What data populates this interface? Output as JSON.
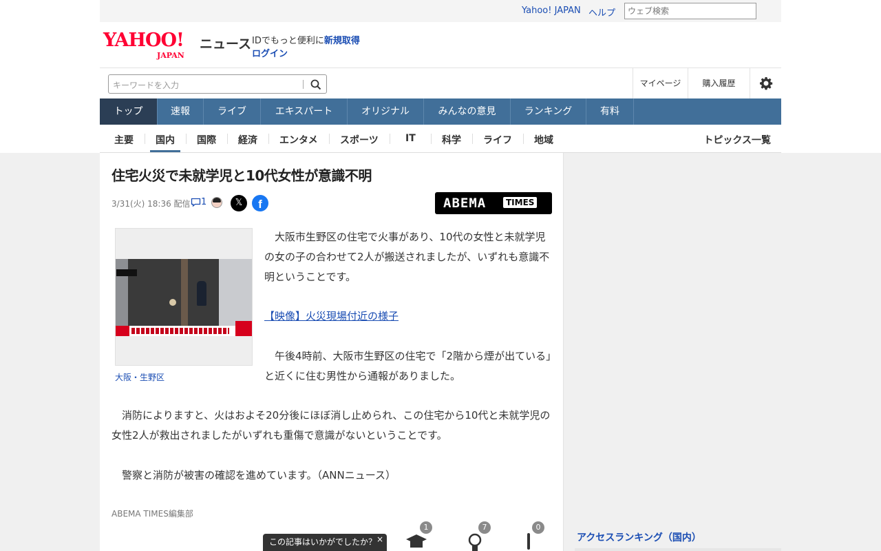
{
  "util": {
    "yahoo_japan": "Yahoo! JAPAN",
    "help": "ヘルプ",
    "web_search_placeholder": "ウェブ検索"
  },
  "header": {
    "logo_main": "YAHOO!",
    "logo_sub": "JAPAN",
    "service_name": "ニュース",
    "id_text": "IDでもっと便利に",
    "signup": "新規取得",
    "login": "ログイン"
  },
  "search": {
    "placeholder": "キーワードを入力",
    "mypage": "マイページ",
    "history": "購入履歴"
  },
  "main_nav": [
    {
      "label": "トップ",
      "active": true
    },
    {
      "label": "速報"
    },
    {
      "label": "ライブ"
    },
    {
      "label": "エキスパート"
    },
    {
      "label": "オリジナル"
    },
    {
      "label": "みんなの意見"
    },
    {
      "label": "ランキング"
    },
    {
      "label": "有料"
    }
  ],
  "sub_nav": [
    {
      "label": "主要"
    },
    {
      "label": "国内",
      "active": true
    },
    {
      "label": "国際"
    },
    {
      "label": "経済"
    },
    {
      "label": "エンタメ"
    },
    {
      "label": "スポーツ"
    },
    {
      "label": "IT"
    },
    {
      "label": "科学"
    },
    {
      "label": "ライフ"
    },
    {
      "label": "地域"
    }
  ],
  "topics_all": "トピックス一覧",
  "article": {
    "headline": "住宅火災で未就学児と10代女性が意識不明",
    "datetime": "3/31(火) 18:36",
    "delivered": "配信",
    "comment_count": "1",
    "share_x": "𝕏",
    "share_fb": "f",
    "source_logo_main": "ABEMA",
    "source_logo_tag": "TIMES",
    "photo_caption": "大阪・生野区",
    "paragraph1": "　大阪市生野区の住宅で火事があり、10代の女性と未就学児の女の子の合わせて2人が搬送されましたが、いずれも意識不明ということです。",
    "video_link": "【映像】火災現場付近の様子",
    "paragraph2": "　午後4時前、大阪市生野区の住宅で「2階から煙が出ている」と近くに住む男性から通報がありました。",
    "paragraph3": "　消防によりますと、火はおよそ20分後にほぼ消し止められ、この住宅から10代と未就学児の女性2人が救出されましたがいずれも重傷で意識がないということです。",
    "paragraph4": "　警察と消防が被害の確認を進めています。（ANNニュース）",
    "byline": "ABEMA TIMES編集部"
  },
  "reactions": {
    "prompt": "この記事はいかがでしたか？",
    "close": "×",
    "learn_count": "1",
    "idea_count": "7",
    "concern_count": "0"
  },
  "sidebar": {
    "ranking_title": "アクセスランキング（国内）"
  },
  "colors": {
    "nav_bg": "#416f99",
    "nav_active": "#2b3e55",
    "link": "#1a4db3",
    "logo_red": "#ff0033"
  }
}
